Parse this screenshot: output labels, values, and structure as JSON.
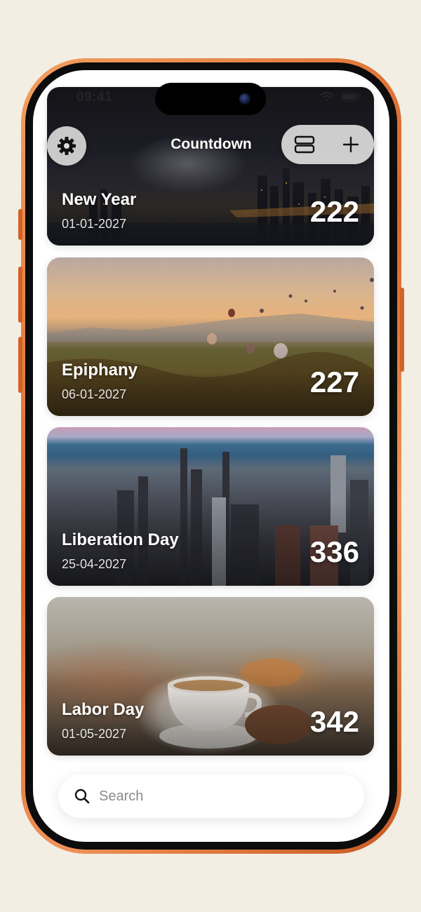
{
  "status_bar": {
    "time": "09:41"
  },
  "header": {
    "title": "Countdown"
  },
  "icons": {
    "settings": "gear-icon",
    "layout": "layout-toggle-icon",
    "add": "plus-icon",
    "search": "search-icon"
  },
  "events": [
    {
      "name": "New Year",
      "date": "01-01-2027",
      "days": "222"
    },
    {
      "name": "Epiphany",
      "date": "06-01-2027",
      "days": "227"
    },
    {
      "name": "Liberation Day",
      "date": "25-04-2027",
      "days": "336"
    },
    {
      "name": "Labor Day",
      "date": "01-05-2027",
      "days": "342"
    }
  ],
  "search": {
    "placeholder": "Search"
  },
  "colors": {
    "frame": "#d8662a",
    "background": "#f3eee4"
  }
}
